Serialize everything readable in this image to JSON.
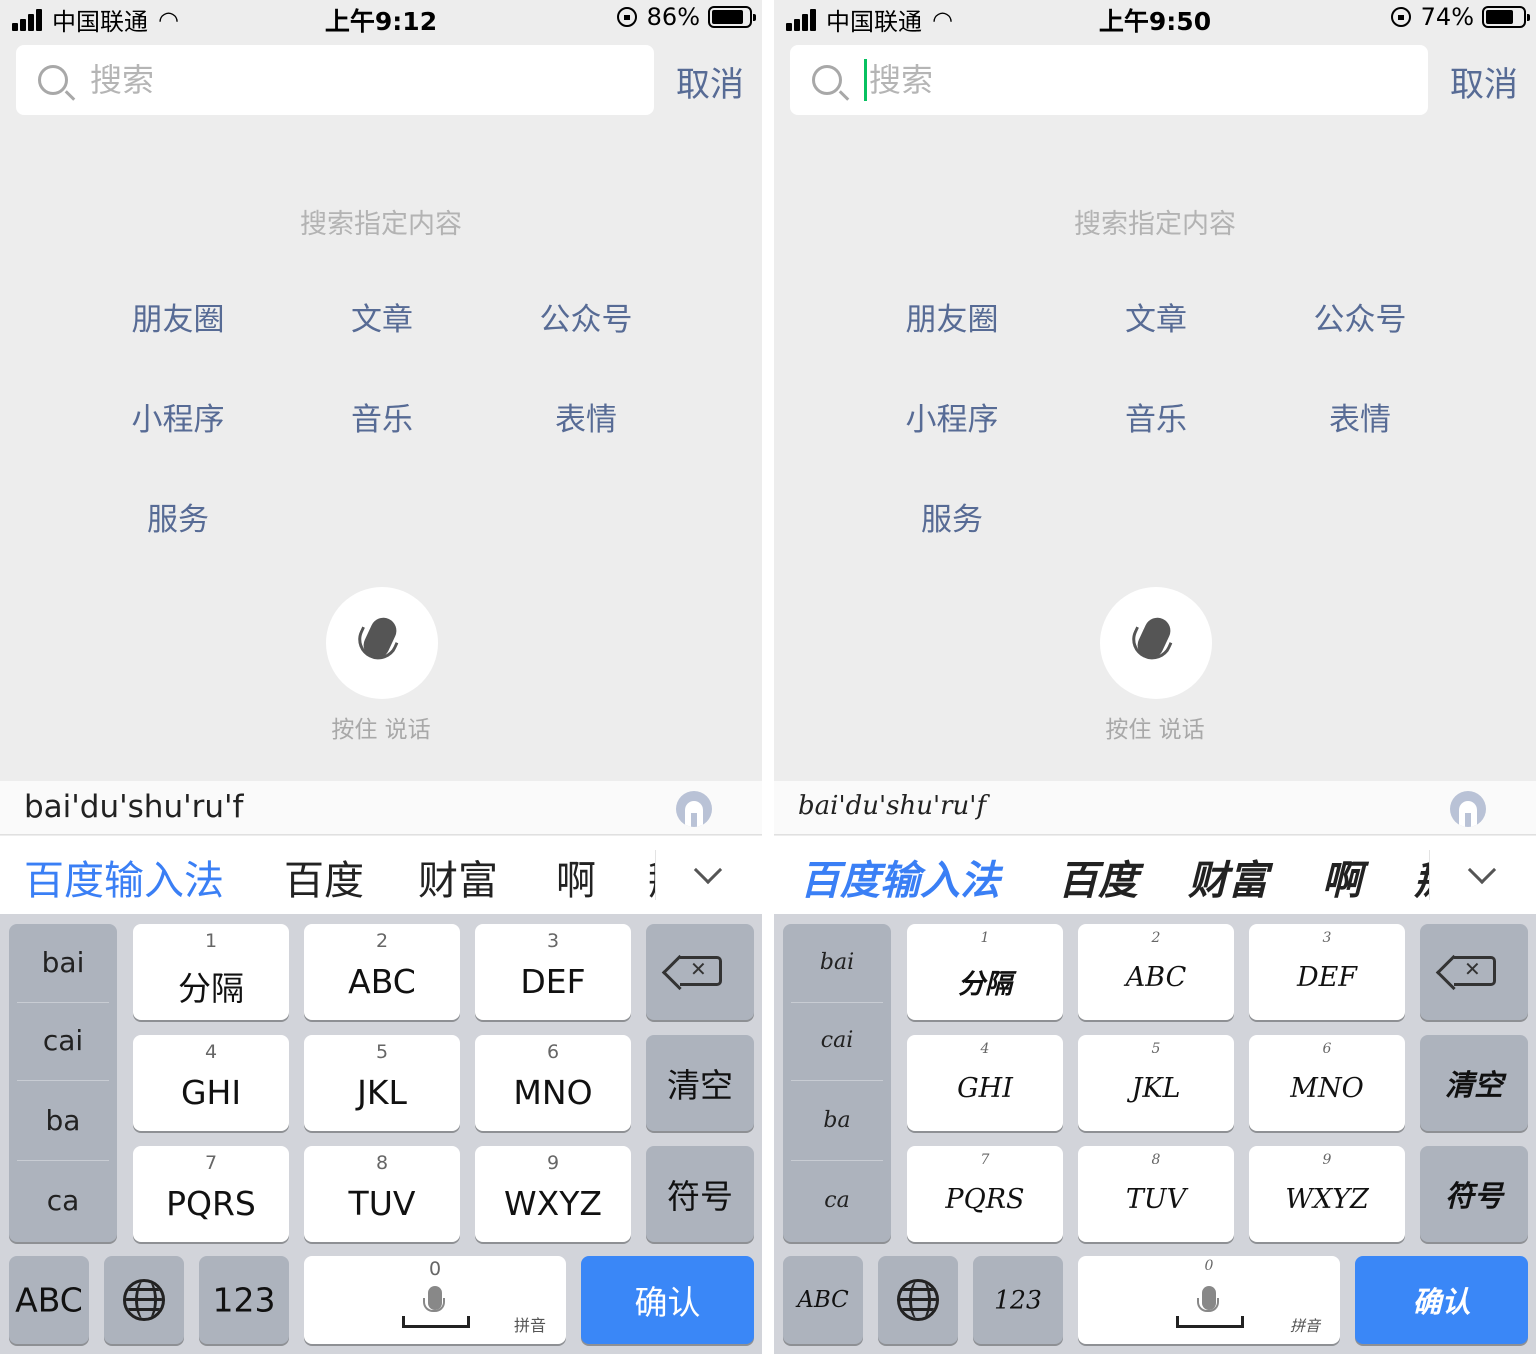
{
  "screens": [
    {
      "status": {
        "carrier": "中国联通",
        "time": "上午9:12",
        "battery": "86%",
        "battery_level": 0.86
      },
      "search": {
        "placeholder": "搜索",
        "cancel_label": "取消"
      },
      "hint_title": "搜索指定内容",
      "categories": [
        "朋友圈",
        "文章",
        "公众号",
        "小程序",
        "音乐",
        "表情",
        "服务"
      ],
      "voice_label": "按住 说话",
      "ime": {
        "pinyin": "bai'du'shu'ru'f",
        "candidates": [
          "百度输入法",
          "百度",
          "财富",
          "啊",
          "掰"
        ],
        "syllables": [
          "bai",
          "cai",
          "ba",
          "ca"
        ],
        "keys": [
          {
            "num": "1",
            "label": "分隔"
          },
          {
            "num": "2",
            "label": "ABC"
          },
          {
            "num": "3",
            "label": "DEF"
          },
          {
            "num": "4",
            "label": "GHI"
          },
          {
            "num": "5",
            "label": "JKL"
          },
          {
            "num": "6",
            "label": "MNO"
          },
          {
            "num": "7",
            "label": "PQRS"
          },
          {
            "num": "8",
            "label": "TUV"
          },
          {
            "num": "9",
            "label": "WXYZ"
          }
        ],
        "clear_label": "清空",
        "symbol_label": "符号",
        "abc_label": "ABC",
        "num_label": "123",
        "space_num": "0",
        "space_sub": "拼音",
        "confirm_label": "确认"
      },
      "icons": [
        "search-icon",
        "chevron-down-icon",
        "backspace-icon",
        "globe-icon",
        "mic-icon"
      ],
      "colors": {
        "link": "#576b95",
        "accent": "#3a87f7",
        "cursor": "#07c160"
      }
    },
    {
      "status": {
        "carrier": "中国联通",
        "time": "上午9:50",
        "battery": "74%",
        "battery_level": 0.74
      },
      "search": {
        "placeholder": "搜索",
        "cancel_label": "取消"
      },
      "hint_title": "搜索指定内容",
      "categories": [
        "朋友圈",
        "文章",
        "公众号",
        "小程序",
        "音乐",
        "表情",
        "服务"
      ],
      "voice_label": "按住 说话",
      "ime": {
        "pinyin": "bai'du'shu'ru'f",
        "candidates": [
          "百度输入法",
          "百度",
          "财富",
          "啊",
          "掰"
        ],
        "syllables": [
          "bai",
          "cai",
          "ba",
          "ca"
        ],
        "keys": [
          {
            "num": "1",
            "label": "分隔"
          },
          {
            "num": "2",
            "label": "ABC"
          },
          {
            "num": "3",
            "label": "DEF"
          },
          {
            "num": "4",
            "label": "GHI"
          },
          {
            "num": "5",
            "label": "JKL"
          },
          {
            "num": "6",
            "label": "MNO"
          },
          {
            "num": "7",
            "label": "PQRS"
          },
          {
            "num": "8",
            "label": "TUV"
          },
          {
            "num": "9",
            "label": "WXYZ"
          }
        ],
        "clear_label": "清空",
        "symbol_label": "符号",
        "abc_label": "ABC",
        "num_label": "123",
        "space_num": "0",
        "space_sub": "拼音",
        "confirm_label": "确认"
      },
      "icons": [
        "search-icon",
        "chevron-down-icon",
        "backspace-icon",
        "globe-icon",
        "mic-icon"
      ],
      "colors": {
        "link": "#576b95",
        "accent": "#3a87f7",
        "cursor": "#07c160"
      }
    }
  ]
}
